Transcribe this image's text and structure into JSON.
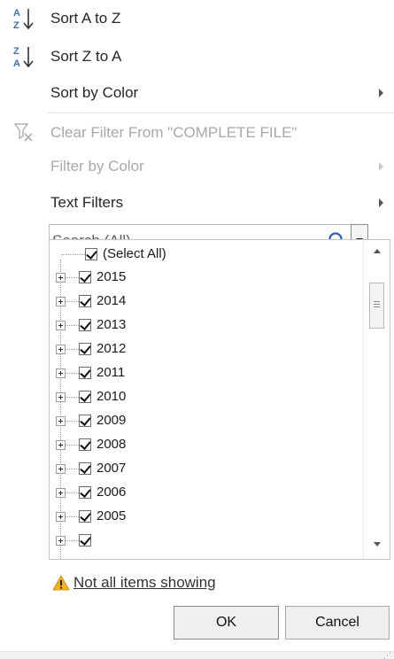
{
  "menu": {
    "sort_az": "Sort A to Z",
    "sort_za": "Sort Z to A",
    "sort_by_color": "Sort by Color",
    "clear_filter": "Clear Filter From \"COMPLETE FILE\"",
    "filter_by_color": "Filter by Color",
    "text_filters": "Text Filters"
  },
  "search": {
    "placeholder": "Search (All)"
  },
  "list": {
    "select_all": "(Select All)",
    "items": [
      "2015",
      "2014",
      "2013",
      "2012",
      "2011",
      "2010",
      "2009",
      "2008",
      "2007",
      "2006",
      "2005"
    ]
  },
  "warning": {
    "text": "Not all items showing"
  },
  "buttons": {
    "ok": "OK",
    "cancel": "Cancel"
  },
  "icons": {
    "sort_az": "sort-ascending-icon",
    "sort_za": "sort-descending-icon",
    "clear_filter": "clear-filter-icon",
    "search": "search-icon",
    "warning": "warning-icon"
  },
  "colors": {
    "az_blue": "#3f6fb6",
    "warning_yellow": "#f2b21b",
    "search_blue": "#2a5fb0"
  }
}
